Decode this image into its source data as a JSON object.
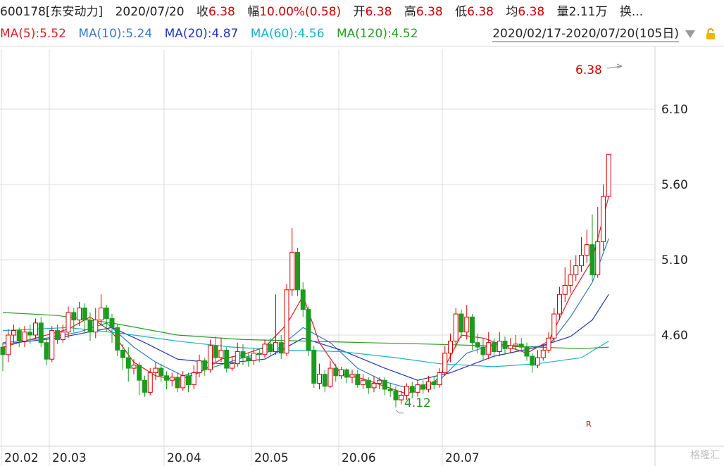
{
  "header": {
    "code_name": "600178[东安动力]",
    "date": "2020/07/20",
    "close": {
      "label": "收",
      "value": "6.38"
    },
    "change": {
      "label": "幅",
      "value": "10.00%(0.58)"
    },
    "open": {
      "label": "开",
      "value": "6.38"
    },
    "high": {
      "label": "高",
      "value": "6.38"
    },
    "low": {
      "label": "低",
      "value": "6.38"
    },
    "avg": {
      "label": "均",
      "value": "6.38"
    },
    "volume": {
      "label": "量",
      "value": "2.11万"
    },
    "turnover": {
      "label": "换..."
    }
  },
  "ma_legend": [
    {
      "text": "MA(5):5.52",
      "color": "#d81e1e"
    },
    {
      "text": "MA(10):5.24",
      "color": "#3a7abf"
    },
    {
      "text": "MA(20):4.87",
      "color": "#1f35b8"
    },
    {
      "text": "MA(60):4.56",
      "color": "#18b2c4"
    },
    {
      "text": "MA(120):4.52",
      "color": "#2a9a2a"
    }
  ],
  "range_label": "2020/02/17-2020/07/20(105日)",
  "annotations": {
    "high": "6.38",
    "low": "4.12",
    "marker": "R"
  },
  "watermark": "格隆汇",
  "chart_data": {
    "type": "candlestick",
    "y_ticks": [
      6.1,
      5.6,
      5.1,
      4.6
    ],
    "y_tick_labels": [
      "6.10",
      "5.60",
      "5.10",
      "4.60"
    ],
    "x_tick_labels": [
      "20.02",
      "20.03",
      "20.04",
      "20.05",
      "20.06",
      "20.07"
    ],
    "x_tick_index": [
      0,
      8,
      29,
      45,
      61,
      80
    ],
    "up_color": "#d20000",
    "down_color": "#1e9a1e",
    "candles": [
      [
        4.52,
        4.47,
        4.55,
        4.36
      ],
      [
        4.47,
        4.6,
        4.64,
        4.42
      ],
      [
        4.6,
        4.63,
        4.67,
        4.55
      ],
      [
        4.63,
        4.56,
        4.65,
        4.52
      ],
      [
        4.56,
        4.62,
        4.66,
        4.52
      ],
      [
        4.62,
        4.6,
        4.67,
        4.54
      ],
      [
        4.6,
        4.68,
        4.71,
        4.57
      ],
      [
        4.68,
        4.55,
        4.72,
        4.52
      ],
      [
        4.55,
        4.44,
        4.58,
        4.4
      ],
      [
        4.44,
        4.63,
        4.66,
        4.42
      ],
      [
        4.63,
        4.57,
        4.67,
        4.54
      ],
      [
        4.57,
        4.62,
        4.67,
        4.55
      ],
      [
        4.62,
        4.75,
        4.79,
        4.58
      ],
      [
        4.75,
        4.7,
        4.78,
        4.62
      ],
      [
        4.7,
        4.78,
        4.82,
        4.66
      ],
      [
        4.78,
        4.7,
        4.81,
        4.61
      ],
      [
        4.7,
        4.62,
        4.75,
        4.56
      ],
      [
        4.62,
        4.7,
        4.78,
        4.58
      ],
      [
        4.7,
        4.78,
        4.87,
        4.66
      ],
      [
        4.78,
        4.71,
        4.8,
        4.62
      ],
      [
        4.71,
        4.65,
        4.74,
        4.55
      ],
      [
        4.65,
        4.5,
        4.67,
        4.46
      ],
      [
        4.5,
        4.45,
        4.54,
        4.37
      ],
      [
        4.45,
        4.38,
        4.52,
        4.29
      ],
      [
        4.38,
        4.4,
        4.44,
        4.34
      ],
      [
        4.4,
        4.3,
        4.42,
        4.2
      ],
      [
        4.3,
        4.22,
        4.33,
        4.19
      ],
      [
        4.22,
        4.35,
        4.38,
        4.2
      ],
      [
        4.35,
        4.38,
        4.42,
        4.3
      ],
      [
        4.38,
        4.33,
        4.41,
        4.29
      ],
      [
        4.33,
        4.3,
        4.36,
        4.24
      ],
      [
        4.3,
        4.32,
        4.35,
        4.26
      ],
      [
        4.32,
        4.25,
        4.35,
        4.22
      ],
      [
        4.25,
        4.33,
        4.36,
        4.23
      ],
      [
        4.33,
        4.27,
        4.35,
        4.22
      ],
      [
        4.27,
        4.35,
        4.4,
        4.24
      ],
      [
        4.35,
        4.43,
        4.47,
        4.32
      ],
      [
        4.43,
        4.37,
        4.45,
        4.33
      ],
      [
        4.37,
        4.53,
        4.57,
        4.35
      ],
      [
        4.53,
        4.45,
        4.59,
        4.41
      ],
      [
        4.45,
        4.5,
        4.58,
        4.42
      ],
      [
        4.5,
        4.38,
        4.52,
        4.35
      ],
      [
        4.38,
        4.41,
        4.46,
        4.36
      ],
      [
        4.41,
        4.49,
        4.55,
        4.39
      ],
      [
        4.49,
        4.45,
        4.54,
        4.4
      ],
      [
        4.45,
        4.43,
        4.48,
        4.39
      ],
      [
        4.43,
        4.48,
        4.51,
        4.4
      ],
      [
        4.48,
        4.47,
        4.51,
        4.42
      ],
      [
        4.47,
        4.54,
        4.57,
        4.45
      ],
      [
        4.54,
        4.49,
        4.58,
        4.46
      ],
      [
        4.49,
        4.55,
        4.87,
        4.47
      ],
      [
        4.55,
        4.48,
        4.6,
        4.44
      ],
      [
        4.48,
        4.9,
        4.94,
        4.46
      ],
      [
        4.9,
        5.15,
        5.31,
        4.86
      ],
      [
        5.15,
        4.9,
        5.18,
        4.86
      ],
      [
        4.9,
        4.77,
        4.95,
        4.72
      ],
      [
        4.77,
        4.5,
        4.79,
        4.46
      ],
      [
        4.5,
        4.28,
        4.53,
        4.25
      ],
      [
        4.28,
        4.34,
        4.41,
        4.24
      ],
      [
        4.34,
        4.26,
        4.37,
        4.22
      ],
      [
        4.26,
        4.38,
        4.43,
        4.25
      ],
      [
        4.38,
        4.33,
        4.41,
        4.29
      ],
      [
        4.33,
        4.37,
        4.39,
        4.31
      ],
      [
        4.37,
        4.32,
        4.38,
        4.28
      ],
      [
        4.32,
        4.34,
        4.37,
        4.28
      ],
      [
        4.34,
        4.27,
        4.37,
        4.25
      ],
      [
        4.27,
        4.3,
        4.34,
        4.24
      ],
      [
        4.3,
        4.25,
        4.32,
        4.21
      ],
      [
        4.25,
        4.28,
        4.33,
        4.22
      ],
      [
        4.28,
        4.3,
        4.32,
        4.24
      ],
      [
        4.3,
        4.24,
        4.32,
        4.2
      ],
      [
        4.24,
        4.23,
        4.28,
        4.19
      ],
      [
        4.23,
        4.17,
        4.26,
        4.12
      ],
      [
        4.17,
        4.2,
        4.23,
        4.14
      ],
      [
        4.2,
        4.26,
        4.28,
        4.17
      ],
      [
        4.26,
        4.22,
        4.29,
        4.18
      ],
      [
        4.22,
        4.27,
        4.3,
        4.19
      ],
      [
        4.27,
        4.24,
        4.3,
        4.21
      ],
      [
        4.24,
        4.29,
        4.33,
        4.22
      ],
      [
        4.29,
        4.27,
        4.33,
        4.24
      ],
      [
        4.27,
        4.35,
        4.38,
        4.25
      ],
      [
        4.35,
        4.48,
        4.53,
        4.33
      ],
      [
        4.48,
        4.56,
        4.61,
        4.42
      ],
      [
        4.56,
        4.74,
        4.78,
        4.52
      ],
      [
        4.74,
        4.62,
        4.77,
        4.58
      ],
      [
        4.62,
        4.72,
        4.8,
        4.57
      ],
      [
        4.72,
        4.55,
        4.74,
        4.5
      ],
      [
        4.55,
        4.52,
        4.61,
        4.48
      ],
      [
        4.52,
        4.47,
        4.58,
        4.43
      ],
      [
        4.47,
        4.55,
        4.62,
        4.44
      ],
      [
        4.55,
        4.49,
        4.58,
        4.45
      ],
      [
        4.49,
        4.56,
        4.62,
        4.46
      ],
      [
        4.56,
        4.51,
        4.59,
        4.47
      ],
      [
        4.51,
        4.53,
        4.58,
        4.48
      ],
      [
        4.53,
        4.54,
        4.6,
        4.5
      ],
      [
        4.54,
        4.52,
        4.58,
        4.49
      ],
      [
        4.52,
        4.46,
        4.55,
        4.43
      ],
      [
        4.46,
        4.4,
        4.48,
        4.35
      ],
      [
        4.4,
        4.45,
        4.5,
        4.38
      ],
      [
        4.45,
        4.5,
        4.54,
        4.43
      ],
      [
        4.5,
        4.58,
        4.62,
        4.48
      ],
      [
        4.58,
        4.74,
        4.78,
        4.55
      ],
      [
        4.74,
        4.87,
        4.92,
        4.7
      ],
      [
        4.87,
        4.93,
        5.05,
        4.82
      ],
      [
        4.93,
        5.0,
        5.1,
        4.88
      ],
      [
        5.0,
        5.06,
        5.13,
        4.96
      ],
      [
        5.06,
        5.13,
        5.25,
        5.02
      ],
      [
        5.13,
        5.2,
        5.3,
        5.08
      ],
      [
        5.2,
        5.0,
        5.4,
        4.96
      ],
      [
        5.0,
        5.22,
        5.45,
        4.98
      ],
      [
        5.22,
        5.52,
        5.6,
        5.16
      ],
      [
        5.52,
        5.8,
        5.8,
        5.52
      ]
    ],
    "ma": [
      {
        "name": "MA(5)",
        "color": "#d81e1e",
        "points": [
          [
            0,
            4.52
          ],
          [
            6,
            4.58
          ],
          [
            12,
            4.64
          ],
          [
            16,
            4.72
          ],
          [
            20,
            4.62
          ],
          [
            24,
            4.42
          ],
          [
            28,
            4.33
          ],
          [
            32,
            4.3
          ],
          [
            36,
            4.35
          ],
          [
            40,
            4.44
          ],
          [
            44,
            4.47
          ],
          [
            48,
            4.52
          ],
          [
            52,
            4.67
          ],
          [
            55,
            4.86
          ],
          [
            58,
            4.55
          ],
          [
            62,
            4.34
          ],
          [
            66,
            4.31
          ],
          [
            70,
            4.26
          ],
          [
            74,
            4.21
          ],
          [
            78,
            4.26
          ],
          [
            80,
            4.32
          ],
          [
            84,
            4.6
          ],
          [
            88,
            4.58
          ],
          [
            92,
            4.53
          ],
          [
            96,
            4.48
          ],
          [
            100,
            4.56
          ],
          [
            104,
            4.86
          ],
          [
            108,
            5.1
          ],
          [
            111,
            5.52
          ]
        ]
      },
      {
        "name": "MA(10)",
        "color": "#3a7abf",
        "points": [
          [
            0,
            4.55
          ],
          [
            8,
            4.58
          ],
          [
            14,
            4.62
          ],
          [
            19,
            4.68
          ],
          [
            24,
            4.52
          ],
          [
            28,
            4.42
          ],
          [
            33,
            4.33
          ],
          [
            38,
            4.38
          ],
          [
            44,
            4.45
          ],
          [
            50,
            4.5
          ],
          [
            55,
            4.65
          ],
          [
            60,
            4.55
          ],
          [
            65,
            4.38
          ],
          [
            70,
            4.29
          ],
          [
            75,
            4.24
          ],
          [
            80,
            4.3
          ],
          [
            85,
            4.48
          ],
          [
            90,
            4.54
          ],
          [
            96,
            4.52
          ],
          [
            100,
            4.53
          ],
          [
            104,
            4.72
          ],
          [
            108,
            4.95
          ],
          [
            111,
            5.24
          ]
        ]
      },
      {
        "name": "MA(20)",
        "color": "#1f35b8",
        "points": [
          [
            0,
            4.54
          ],
          [
            10,
            4.58
          ],
          [
            20,
            4.65
          ],
          [
            26,
            4.55
          ],
          [
            32,
            4.44
          ],
          [
            40,
            4.41
          ],
          [
            48,
            4.44
          ],
          [
            55,
            4.58
          ],
          [
            62,
            4.5
          ],
          [
            70,
            4.38
          ],
          [
            76,
            4.3
          ],
          [
            82,
            4.35
          ],
          [
            90,
            4.46
          ],
          [
            98,
            4.52
          ],
          [
            104,
            4.59
          ],
          [
            108,
            4.7
          ],
          [
            111,
            4.87
          ]
        ]
      },
      {
        "name": "MA(60)",
        "color": "#18b2c4",
        "points": [
          [
            0,
            4.63
          ],
          [
            12,
            4.65
          ],
          [
            22,
            4.61
          ],
          [
            32,
            4.56
          ],
          [
            42,
            4.52
          ],
          [
            52,
            4.5
          ],
          [
            62,
            4.49
          ],
          [
            72,
            4.45
          ],
          [
            80,
            4.41
          ],
          [
            90,
            4.39
          ],
          [
            98,
            4.41
          ],
          [
            106,
            4.45
          ],
          [
            111,
            4.56
          ]
        ]
      },
      {
        "name": "MA(120)",
        "color": "#2a9a2a",
        "points": [
          [
            0,
            4.75
          ],
          [
            10,
            4.73
          ],
          [
            20,
            4.68
          ],
          [
            32,
            4.6
          ],
          [
            44,
            4.57
          ],
          [
            56,
            4.56
          ],
          [
            66,
            4.55
          ],
          [
            78,
            4.54
          ],
          [
            88,
            4.53
          ],
          [
            98,
            4.52
          ],
          [
            106,
            4.51
          ],
          [
            111,
            4.52
          ]
        ]
      }
    ],
    "high_point": {
      "index": 111,
      "value": 6.38
    },
    "low_point": {
      "index": 72,
      "value": 4.12
    }
  }
}
